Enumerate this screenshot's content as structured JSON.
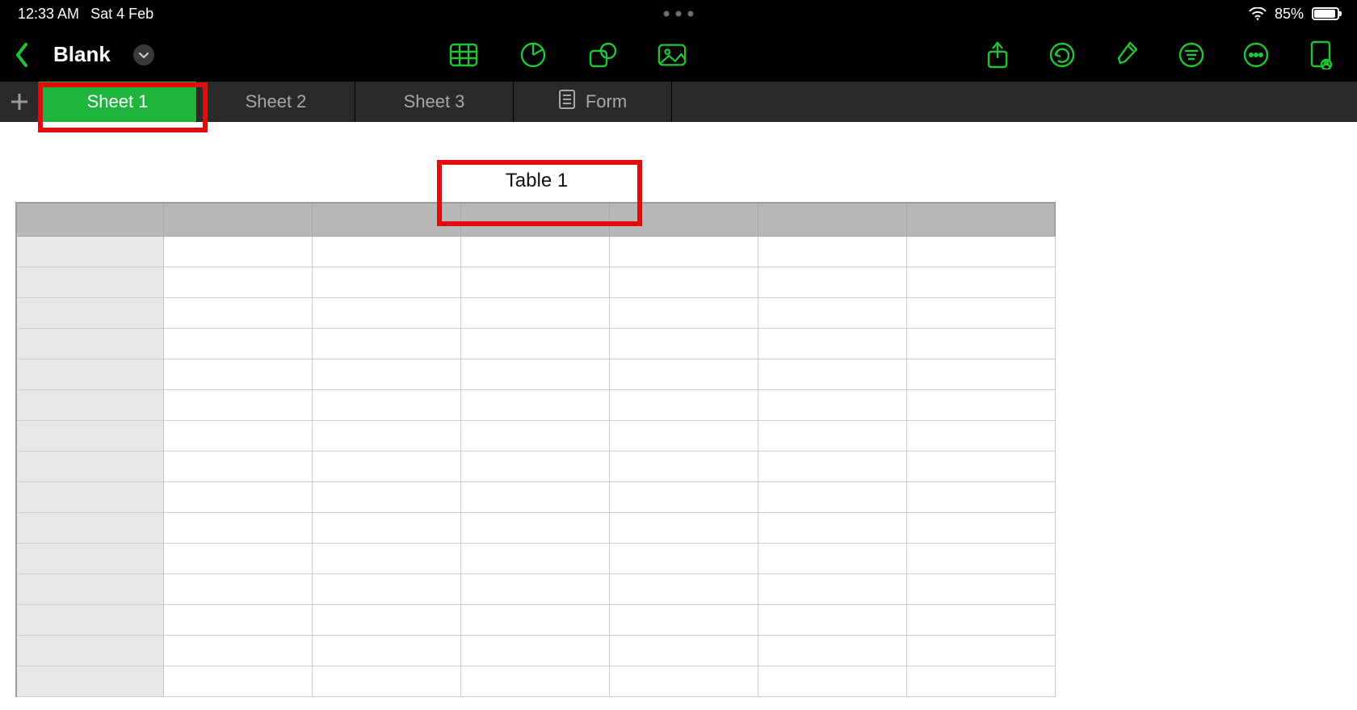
{
  "statusbar": {
    "time": "12:33 AM",
    "date": "Sat 4 Feb",
    "battery_pct": "85%"
  },
  "toolbar": {
    "doc_title": "Blank"
  },
  "tabs": {
    "items": [
      {
        "label": "Sheet 1",
        "active": true,
        "is_form": false
      },
      {
        "label": "Sheet 2",
        "active": false,
        "is_form": false
      },
      {
        "label": "Sheet 3",
        "active": false,
        "is_form": false
      },
      {
        "label": "Form",
        "active": false,
        "is_form": true
      }
    ]
  },
  "table": {
    "title": "Table 1",
    "columns": 7,
    "rows": 15
  },
  "colors": {
    "accent": "#1ec635",
    "annotation": "#e20c0c"
  }
}
